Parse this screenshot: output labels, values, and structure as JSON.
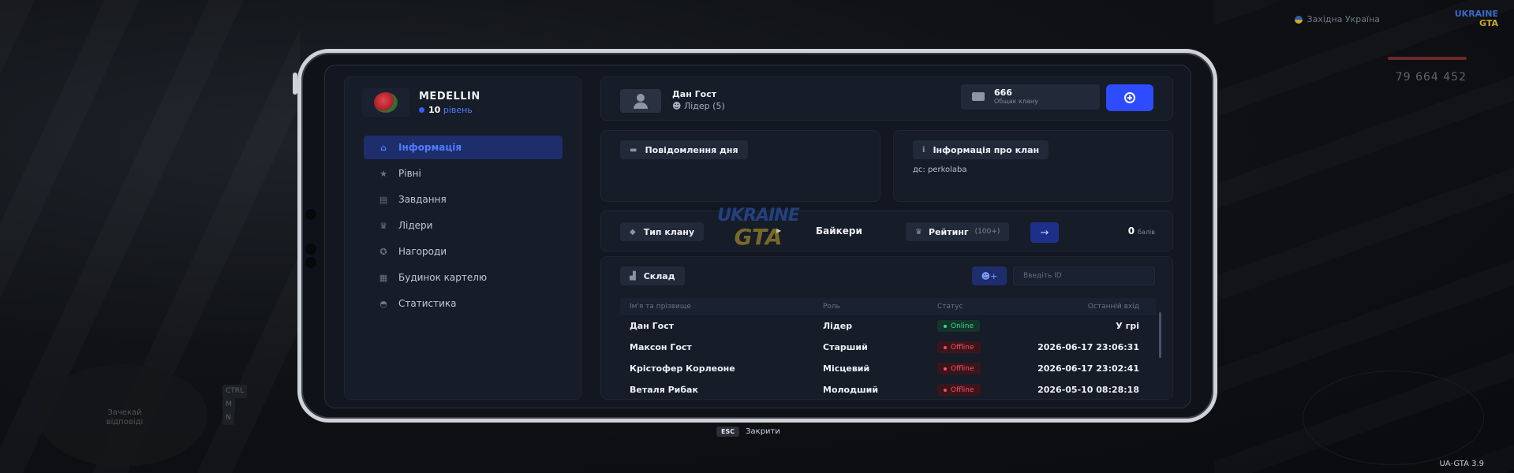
{
  "hud": {
    "server_name": "Західна Україна",
    "logo_line1": "UKRAINE",
    "logo_line2": "GTA",
    "money": "79 664 452",
    "minimap_text": "Зачекай відповіді",
    "keys": [
      {
        "key": "CTRL",
        "label": ""
      },
      {
        "key": "M",
        "label": ""
      },
      {
        "key": "N",
        "label": ""
      }
    ],
    "version": "UA-GTA 3.9"
  },
  "clan": {
    "name": "MEDELLIN",
    "level_num": "10",
    "level_label": "рівень"
  },
  "nav": [
    {
      "label": "Інформація",
      "icon": "home-icon",
      "active": true
    },
    {
      "label": "Рівні",
      "icon": "star-icon",
      "active": false
    },
    {
      "label": "Завдання",
      "icon": "tasks-icon",
      "active": false
    },
    {
      "label": "Лідери",
      "icon": "crown-icon",
      "active": false
    },
    {
      "label": "Нагороди",
      "icon": "award-icon",
      "active": false
    },
    {
      "label": "Будинок картелю",
      "icon": "house-icon",
      "active": false
    },
    {
      "label": "Статистика",
      "icon": "stats-icon",
      "active": false
    }
  ],
  "leader": {
    "name": "Дан Гост",
    "role": "Лідер (5)"
  },
  "bank": {
    "amount": "666",
    "label": "Общак клану"
  },
  "motd": {
    "title": "Повідомлення дня"
  },
  "clan_info": {
    "title": "Інформація про клан",
    "text": "дс: perkolaba"
  },
  "clan_type": {
    "title": "Тип клану",
    "value": "Байкери"
  },
  "rating": {
    "title": "Рейтинг",
    "suffix": "(100+)",
    "score": "0",
    "score_label": "балів"
  },
  "warehouse": {
    "title": "Склад",
    "search_placeholder": "Введіть ID"
  },
  "members_table": {
    "headers": [
      "Ім'я та прізвище",
      "Роль",
      "Статус",
      "Останній вхід"
    ],
    "rows": [
      {
        "name": "Дан Гост",
        "role": "Лідер",
        "status": "Online",
        "last": "У грі"
      },
      {
        "name": "Максон Гост",
        "role": "Старший",
        "status": "Offline",
        "last": "2026-06-17 23:06:31"
      },
      {
        "name": "Крістофер Корлеоне",
        "role": "Місцевий",
        "status": "Offline",
        "last": "2026-06-17 23:02:41"
      },
      {
        "name": "Веталя Рибак",
        "role": "Молодший",
        "status": "Offline",
        "last": "2026-05-10 08:28:18"
      }
    ]
  },
  "watermark": {
    "line1": "UKRAINE",
    "line2": "GTA"
  },
  "footer": {
    "key": "ESC",
    "label": "Закрити"
  },
  "colors": {
    "accent": "#2d4bff",
    "online": "#3bd98a",
    "offline": "#ff4d5e"
  }
}
